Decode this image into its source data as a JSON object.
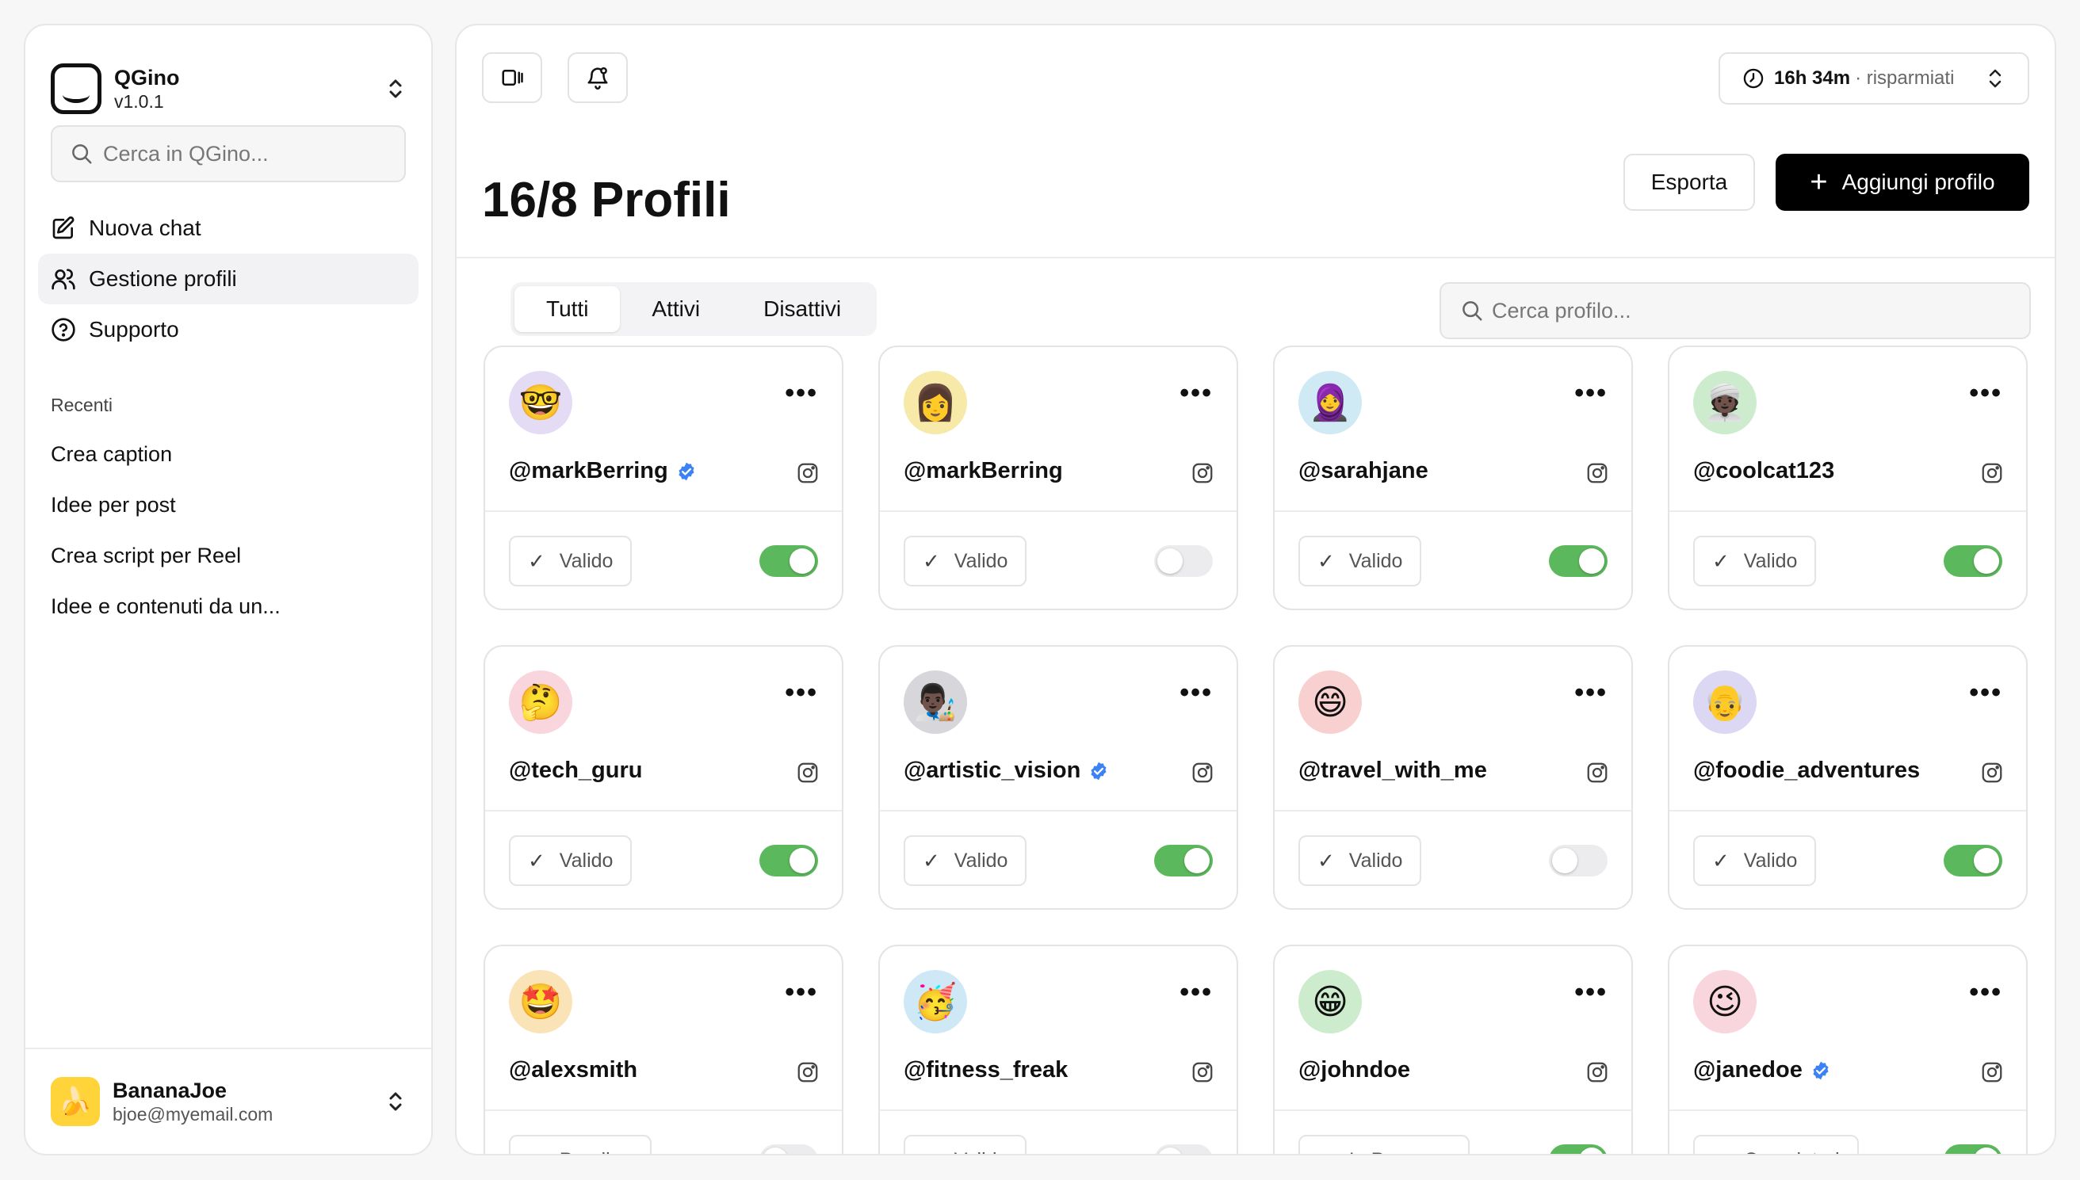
{
  "app": {
    "name": "QGino",
    "version": "v1.0.1"
  },
  "sidebar": {
    "search_placeholder": "Cerca in QGino...",
    "nav": [
      {
        "label": "Nuova chat",
        "icon": "edit-icon"
      },
      {
        "label": "Gestione profili",
        "icon": "users-icon",
        "active": true
      },
      {
        "label": "Supporto",
        "icon": "help-circle-icon"
      }
    ],
    "recent_title": "Recenti",
    "recent": [
      "Crea caption",
      "Idee per post",
      "Crea script per Reel",
      "Idee e contenuti da un..."
    ],
    "user": {
      "name": "BananaJoe",
      "email": "bjoe@myemail.com",
      "avatar": "🍌"
    }
  },
  "topbar": {
    "timer_value": "16h 34m",
    "timer_suffix": "· risparmiati"
  },
  "header": {
    "title_strong": "16/8",
    "title_rest": "Profili",
    "export_label": "Esporta",
    "add_label": "Aggiungi profilo"
  },
  "filters": {
    "tabs": [
      "Tutti",
      "Attivi",
      "Disattivi"
    ],
    "active_tab": "Tutti",
    "search_placeholder": "Cerca profilo..."
  },
  "colors": {
    "accent": "#000000",
    "toggle_on": "#5cb85c",
    "verified": "#3b82f6"
  },
  "profiles": [
    {
      "handle": "@markBerring",
      "verified": true,
      "status": "Valido",
      "active": true,
      "avatar": "🤓",
      "bg": "#e3dcf4"
    },
    {
      "handle": "@markBerring",
      "verified": false,
      "status": "Valido",
      "active": false,
      "avatar": "👩",
      "bg": "#f7e9a8"
    },
    {
      "handle": "@sarahjane",
      "verified": false,
      "status": "Valido",
      "active": true,
      "avatar": "🧕",
      "bg": "#cfeaf4"
    },
    {
      "handle": "@coolcat123",
      "verified": false,
      "status": "Valido",
      "active": true,
      "avatar": "👳🏿",
      "bg": "#cdeccd"
    },
    {
      "handle": "@tech_guru",
      "verified": false,
      "status": "Valido",
      "active": true,
      "avatar": "🤔",
      "bg": "#f9d5dd"
    },
    {
      "handle": "@artistic_vision",
      "verified": true,
      "status": "Valido",
      "active": true,
      "avatar": "👨🏿‍🎨",
      "bg": "#d6d6db"
    },
    {
      "handle": "@travel_with_me",
      "verified": false,
      "status": "Valido",
      "active": false,
      "avatar": "😄",
      "bg": "#f9d0d0"
    },
    {
      "handle": "@foodie_adventures",
      "verified": false,
      "status": "Valido",
      "active": true,
      "avatar": "👴",
      "bg": "#dcd7f3"
    },
    {
      "handle": "@alexsmith",
      "verified": false,
      "status": "Pending",
      "active": false,
      "avatar": "🤩",
      "bg": "#fbe3b8"
    },
    {
      "handle": "@fitness_freak",
      "verified": false,
      "status": "Valido",
      "active": false,
      "avatar": "🥳",
      "bg": "#cfe8f6"
    },
    {
      "handle": "@johndoe",
      "verified": false,
      "status": "In Progress",
      "active": true,
      "avatar": "😁",
      "bg": "#cdeccd"
    },
    {
      "handle": "@janedoe",
      "verified": true,
      "status": "Completed",
      "active": true,
      "avatar": "😉",
      "bg": "#f9d5dd"
    }
  ]
}
